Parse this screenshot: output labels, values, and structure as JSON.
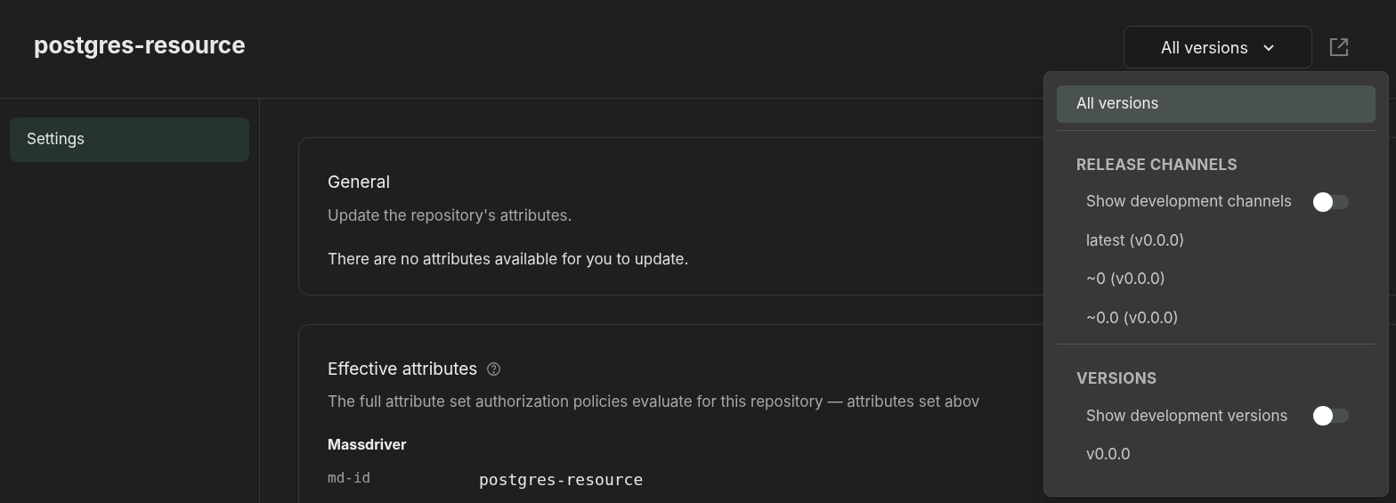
{
  "header": {
    "title": "postgres-resource",
    "version_select": {
      "value": "All versions"
    }
  },
  "sidebar": {
    "items": [
      {
        "label": "Settings",
        "selected": true
      }
    ]
  },
  "cards": [
    {
      "title": "General",
      "description": "Update the repository's attributes.",
      "body": "There are no attributes available for you to update."
    },
    {
      "title": "Effective attributes",
      "help": true,
      "description": "The full attribute set authorization policies evaluate for this repository — attributes set abov",
      "group": "Massdriver",
      "rows": [
        {
          "key": "md-id",
          "value": "postgres-resource"
        }
      ]
    }
  ],
  "dropdown": {
    "sections": [
      {
        "items": [
          {
            "kind": "option",
            "label": "All versions",
            "selected": true
          }
        ]
      },
      {
        "heading": "RELEASE CHANNELS",
        "items": [
          {
            "kind": "toggle",
            "label": "Show development channels",
            "on": false
          },
          {
            "kind": "option",
            "label": "latest (v0.0.0)",
            "selected": false
          },
          {
            "kind": "option",
            "label": "~0 (v0.0.0)",
            "selected": false
          },
          {
            "kind": "option",
            "label": "~0.0 (v0.0.0)",
            "selected": false
          }
        ]
      },
      {
        "heading": "VERSIONS",
        "items": [
          {
            "kind": "toggle",
            "label": "Show development versions",
            "on": false
          },
          {
            "kind": "option",
            "label": "v0.0.0",
            "selected": false
          }
        ]
      }
    ]
  }
}
